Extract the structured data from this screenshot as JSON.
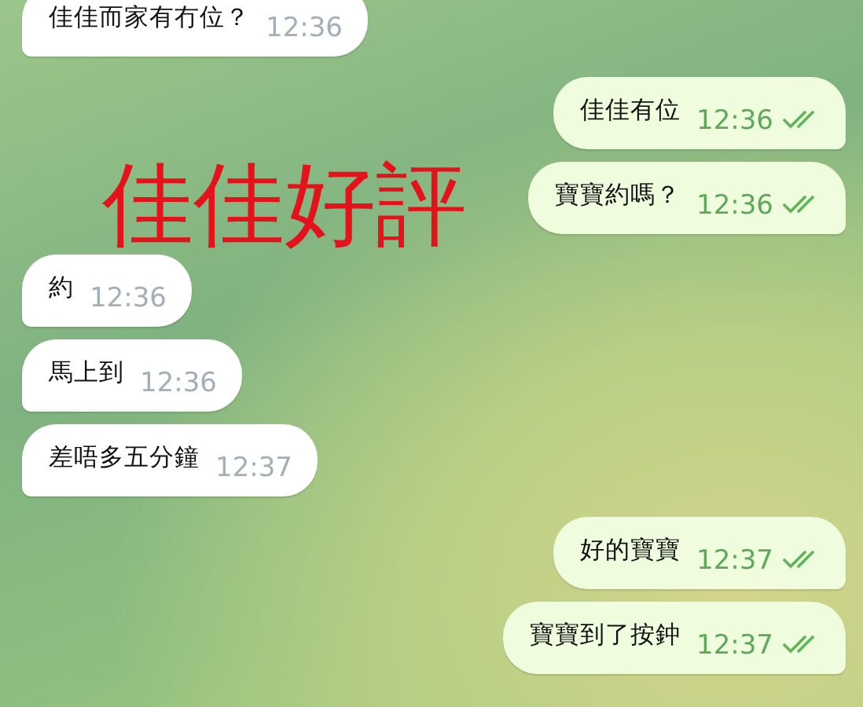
{
  "overlay_text": "佳佳好評",
  "messages": [
    {
      "kind": "incoming",
      "text": "佳佳而家有冇位？",
      "time": "12:36"
    },
    {
      "kind": "outgoing",
      "text": "佳佳有位",
      "time": "12:36",
      "read": true
    },
    {
      "kind": "outgoing",
      "text": "寶寶約嗎？",
      "time": "12:36",
      "read": true
    },
    {
      "kind": "incoming",
      "text": "約",
      "time": "12:36"
    },
    {
      "kind": "incoming",
      "text": "馬上到",
      "time": "12:36"
    },
    {
      "kind": "incoming",
      "text": "差唔多五分鐘",
      "time": "12:37"
    },
    {
      "kind": "outgoing",
      "text": "好的寶寶",
      "time": "12:37",
      "read": true
    },
    {
      "kind": "outgoing",
      "text": "寶寶到了按鈡",
      "time": "12:37",
      "read": true
    }
  ]
}
